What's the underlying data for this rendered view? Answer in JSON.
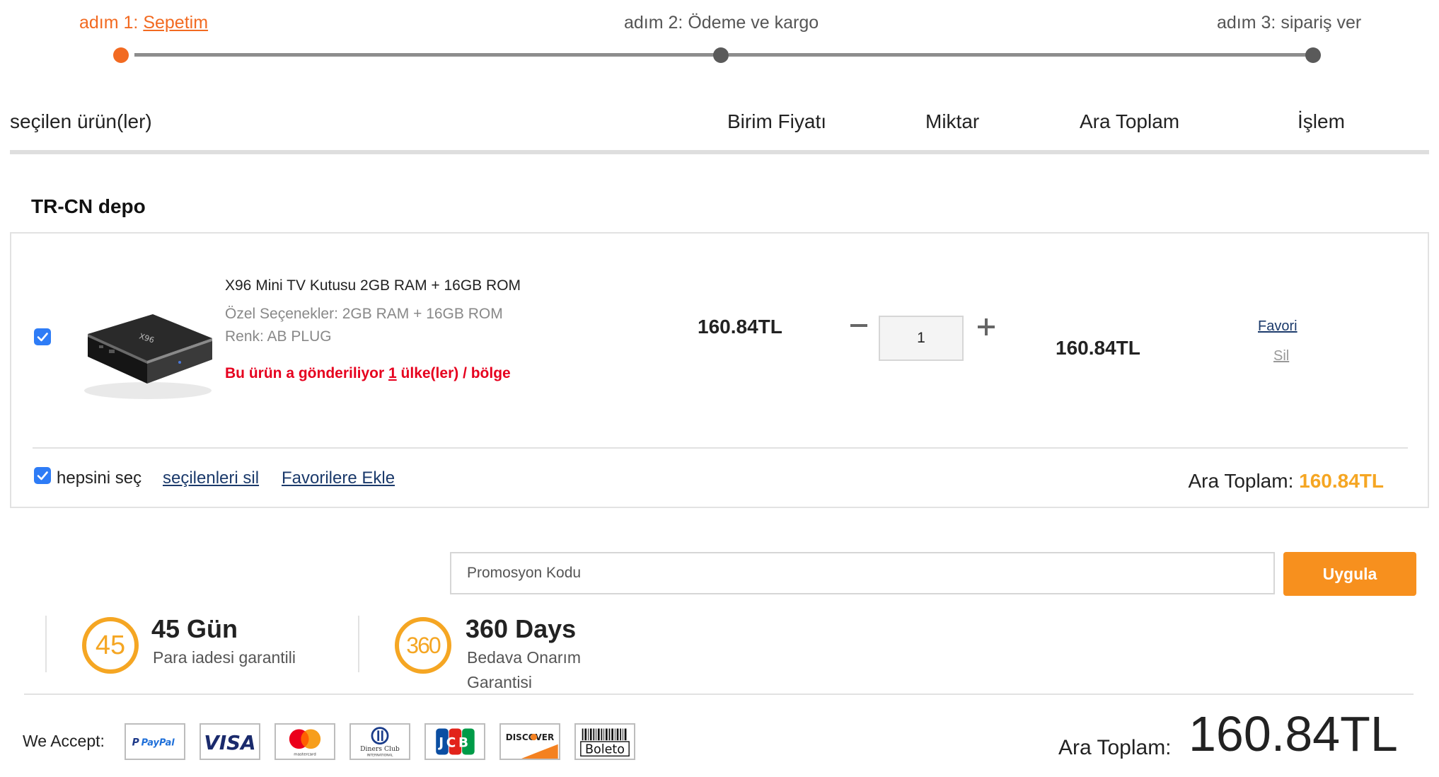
{
  "steps": {
    "step1_prefix": "adım 1: ",
    "step1_link": "Sepetim",
    "step2": "adım 2: Ödeme ve kargo",
    "step3": "adım 3: sipariş ver"
  },
  "table_header": {
    "products": "seçilen ürün(ler)",
    "unit_price": "Birim Fiyatı",
    "quantity": "Miktar",
    "subtotal": "Ara Toplam",
    "action": "İşlem"
  },
  "warehouse": "TR-CN depo",
  "item": {
    "checked": true,
    "title": "X96 Mini TV Kutusu 2GB RAM + 16GB ROM",
    "options": "Özel Seçenekler: 2GB RAM + 16GB ROM",
    "color": "Renk: AB PLUG",
    "ship_prefix": "Bu ürün a gönderiliyor ",
    "ship_count": "1",
    "ship_suffix": " ülke(ler) / bölge",
    "unit_price": "160.84TL",
    "quantity": "1",
    "subtotal": "160.84TL",
    "favorite_link": "Favori",
    "delete_link": "Sil"
  },
  "bulk": {
    "select_all": "hepsini seç",
    "delete_selected": "seçilenleri sil",
    "add_favorites": "Favorilere Ekle",
    "subtotal_label": "Ara Toplam: ",
    "subtotal_value": "160.84TL"
  },
  "promo": {
    "placeholder": "Promosyon Kodu",
    "apply": "Uygula"
  },
  "guarantees": [
    {
      "badge": "45",
      "title": "45 Gün",
      "line1": "Para iadesi garantili",
      "line2": ""
    },
    {
      "badge": "360",
      "title": "360 Days",
      "line1": "Bedava Onarım",
      "line2": "Garantisi"
    }
  ],
  "footer": {
    "we_accept": "We Accept:",
    "payment_icons": [
      "paypal-icon",
      "visa-icon",
      "mastercard-icon",
      "diners-club-icon",
      "jcb-icon",
      "discover-icon",
      "boleto-icon"
    ],
    "payment_labels": {
      "paypal": "PayPal",
      "visa": "VISA",
      "mastercard": "mastercard",
      "diners": "Diners Club",
      "diners_sub": "INTERNATIONAL",
      "jcb": "JCB",
      "discover": "DISCOVER",
      "boleto": "Boleto"
    },
    "grand_label": "Ara Toplam:",
    "grand_amount": "160.84TL"
  },
  "colors": {
    "accent": "#f26a21",
    "button": "#f7901e",
    "total_highlight": "#f5a623",
    "error_red": "#e6001e",
    "link_blue": "#1b3a6b",
    "checkbox_blue": "#2e7cf6"
  }
}
